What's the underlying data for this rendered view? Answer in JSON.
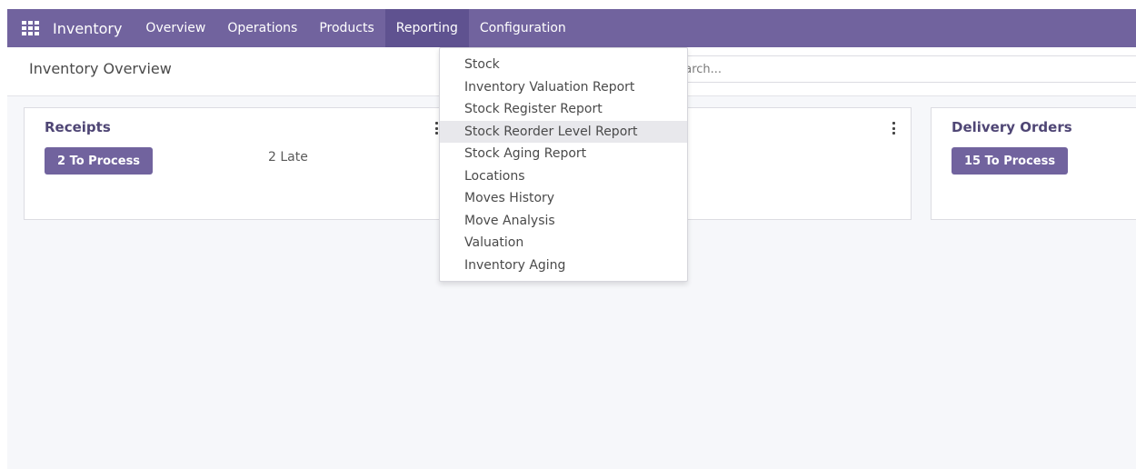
{
  "navbar": {
    "brand": "Inventory",
    "items": [
      {
        "label": "Overview"
      },
      {
        "label": "Operations"
      },
      {
        "label": "Products"
      },
      {
        "label": "Reporting"
      },
      {
        "label": "Configuration"
      }
    ],
    "accent_color": "#71639e"
  },
  "control_panel": {
    "title": "Inventory Overview",
    "search_placeholder": "Search..."
  },
  "cards": {
    "receipts": {
      "title": "Receipts",
      "process_label": "2 To Process",
      "late_label": "2 Late"
    },
    "delivery": {
      "title": "Delivery Orders",
      "process_label": "15 To Process"
    }
  },
  "reporting_menu": {
    "items": [
      {
        "label": "Stock"
      },
      {
        "label": "Inventory Valuation Report"
      },
      {
        "label": "Stock Register Report"
      },
      {
        "label": "Stock Reorder Level Report"
      },
      {
        "label": "Stock Aging Report"
      },
      {
        "label": "Locations"
      },
      {
        "label": "Moves History"
      },
      {
        "label": "Move Analysis"
      },
      {
        "label": "Valuation"
      },
      {
        "label": "Inventory Aging"
      }
    ],
    "highlighted": "Stock Reorder Level Report"
  }
}
